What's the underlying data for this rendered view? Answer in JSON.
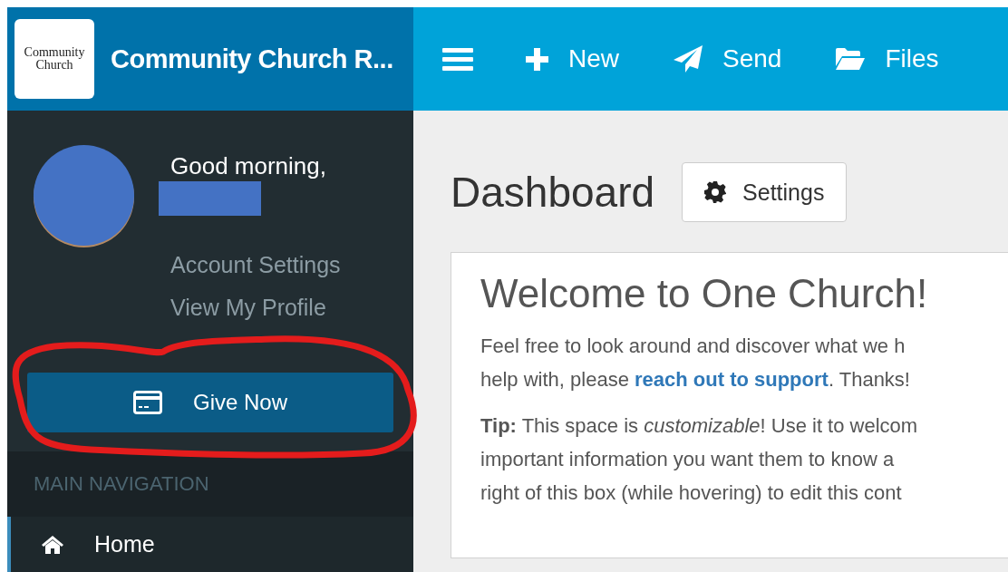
{
  "header": {
    "logo_lines": [
      "Community",
      "Church"
    ],
    "app_title": "Community Church R...",
    "toolbar": [
      {
        "kind": "menu"
      },
      {
        "kind": "new",
        "label": "New"
      },
      {
        "kind": "send",
        "label": "Send"
      },
      {
        "kind": "files",
        "label": "Files"
      }
    ]
  },
  "sidebar": {
    "user": {
      "greeting": "Good morning,",
      "redacted": true
    },
    "links": [
      "Account Settings",
      "View My Profile"
    ],
    "give_button": "Give Now",
    "nav_header": "MAIN NAVIGATION",
    "nav_items": [
      {
        "kind": "home",
        "label": "Home",
        "selected": true
      }
    ]
  },
  "content": {
    "title": "Dashboard",
    "settings_button": "Settings",
    "welcome": {
      "heading": "Welcome to One Church!",
      "paragraphs": [
        [
          {
            "text": "Feel free to look around and discover what we h"
          },
          {
            "text": "help with, please ",
            "link": "reach out to support",
            "after": ". Thanks!"
          }
        ],
        [
          {
            "text": "**Tip:** This space is *customizable*! Use it to welcom"
          },
          {
            "text": "important information you want them to know a"
          },
          {
            "text": "right of this box (while hovering) to edit this cont"
          }
        ]
      ]
    }
  },
  "annotation": {
    "kind": "freehand-circle"
  }
}
